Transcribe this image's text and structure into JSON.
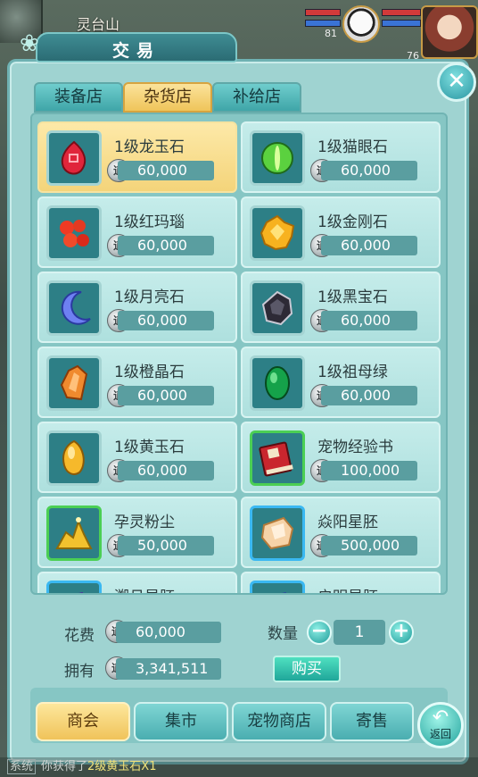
{
  "hud": {
    "map_name": "灵台山",
    "level_left": "81",
    "level_right": "76"
  },
  "window": {
    "title": "交易"
  },
  "shop_tabs": [
    {
      "label": "装备店",
      "active": false
    },
    {
      "label": "杂货店",
      "active": true
    },
    {
      "label": "补给店",
      "active": false
    }
  ],
  "coin_glyph": "道",
  "items": [
    {
      "name": "1级龙玉石",
      "price": "60,000",
      "icon": "red-jade-gem-icon",
      "selected": true
    },
    {
      "name": "1级猫眼石",
      "price": "60,000",
      "icon": "cat-eye-gem-icon"
    },
    {
      "name": "1级红玛瑙",
      "price": "60,000",
      "icon": "red-agate-gem-icon"
    },
    {
      "name": "1级金刚石",
      "price": "60,000",
      "icon": "diamond-gem-icon"
    },
    {
      "name": "1级月亮石",
      "price": "60,000",
      "icon": "moonstone-gem-icon"
    },
    {
      "name": "1级黑宝石",
      "price": "60,000",
      "icon": "black-gem-icon"
    },
    {
      "name": "1级橙晶石",
      "price": "60,000",
      "icon": "orange-crystal-gem-icon"
    },
    {
      "name": "1级祖母绿",
      "price": "60,000",
      "icon": "emerald-gem-icon"
    },
    {
      "name": "1级黄玉石",
      "price": "60,000",
      "icon": "yellow-jade-gem-icon"
    },
    {
      "name": "宠物经验书",
      "price": "100,000",
      "icon": "pet-exp-book-icon"
    },
    {
      "name": "孕灵粉尘",
      "price": "50,000",
      "icon": "spirit-dust-icon"
    },
    {
      "name": "焱阳星胚",
      "price": "500,000",
      "icon": "sun-star-embryo-icon"
    },
    {
      "name": "溯月星胚",
      "price": "",
      "icon": "moon-star-embryo-icon"
    },
    {
      "name": "启明星胚",
      "price": "",
      "icon": "dawn-star-embryo-icon"
    }
  ],
  "footer": {
    "cost_label": "花费",
    "cost_value": "60,000",
    "own_label": "拥有",
    "own_value": "3,341,511",
    "qty_label": "数量",
    "qty_value": "1",
    "minus": "−",
    "plus": "+",
    "buy_label": "购买"
  },
  "bottom_tabs": [
    {
      "label": "商会",
      "active": true
    },
    {
      "label": "集市",
      "active": false
    },
    {
      "label": "宠物商店",
      "active": false
    },
    {
      "label": "寄售",
      "active": false
    }
  ],
  "back_label": "返回",
  "chat": {
    "tag": "系统",
    "text": "你获得了",
    "item": "2级黄玉石X1"
  }
}
